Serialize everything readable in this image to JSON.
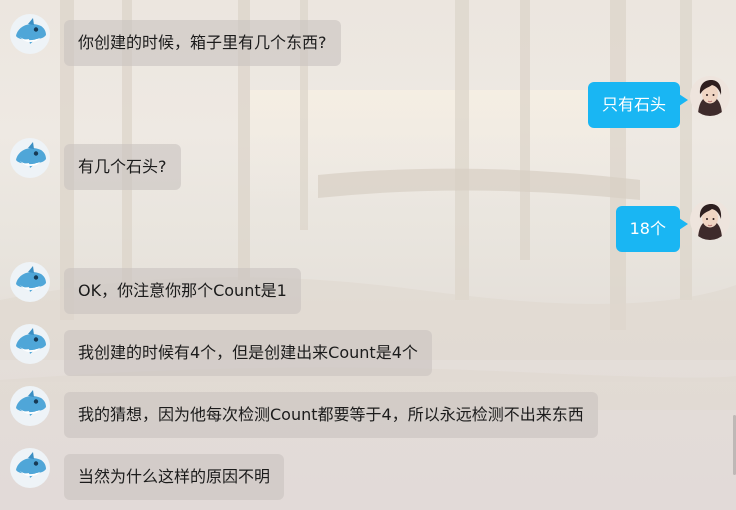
{
  "messages": [
    {
      "side": "bot",
      "text": "你创建的时候，箱子里有几个东西?"
    },
    {
      "side": "user",
      "text": "只有石头"
    },
    {
      "side": "bot",
      "text": "有几个石头?"
    },
    {
      "side": "user",
      "text": "18个"
    },
    {
      "side": "bot",
      "text": "OK，你注意你那个Count是1"
    },
    {
      "side": "bot",
      "text": "我创建的时候有4个，但是创建出来Count是4个"
    },
    {
      "side": "bot",
      "text": "我的猜想，因为他每次检测Count都要等于4，所以永远检测不出来东西"
    },
    {
      "side": "bot",
      "text": "当然为什么这样的原因不明"
    }
  ],
  "icons": {
    "bot_avatar": "dolphin-icon",
    "user_avatar": "user-portrait-icon"
  },
  "colors": {
    "user_bubble": "#19b6f3",
    "bot_bubble": "#cac4c0"
  }
}
